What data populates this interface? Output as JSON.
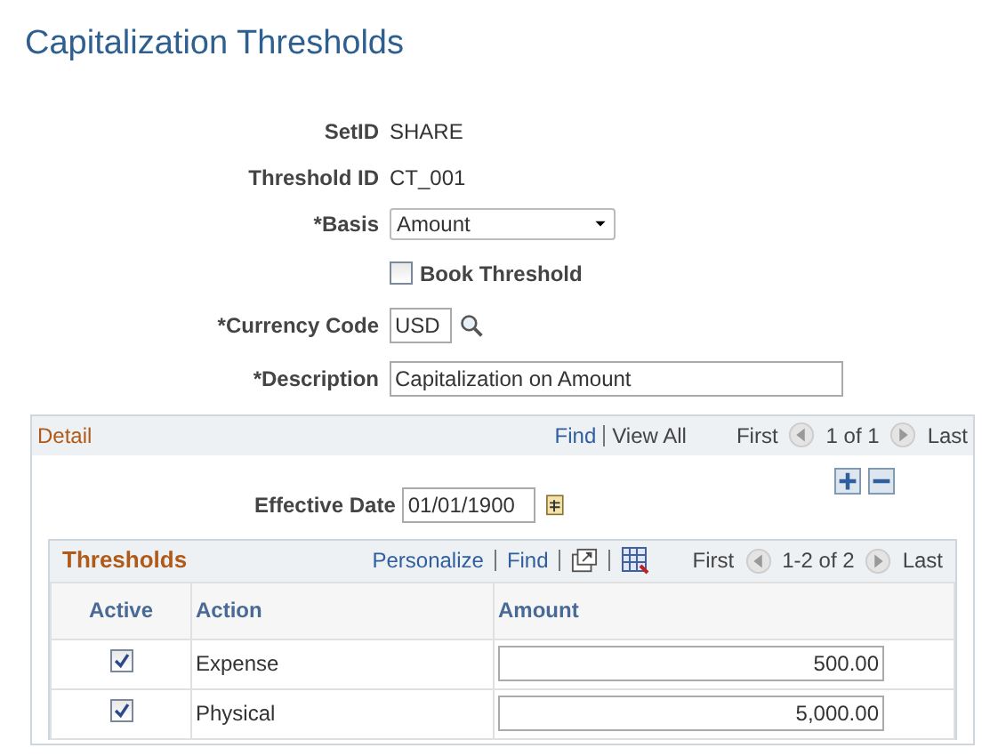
{
  "page_title": "Capitalization Thresholds",
  "fields": [
    {
      "kind": "text",
      "label": "SetID",
      "value": "SHARE"
    },
    {
      "kind": "text",
      "label": "Threshold ID",
      "value": "CT_001"
    },
    {
      "kind": "select",
      "label": "*Basis",
      "value": "Amount"
    },
    {
      "kind": "checkbox",
      "label": "Book Threshold",
      "checked": false
    },
    {
      "kind": "lookup",
      "label": "*Currency Code",
      "value": "USD"
    },
    {
      "kind": "input",
      "label": "*Description",
      "value": "Capitalization on Amount"
    }
  ],
  "detail": {
    "title": "Detail",
    "find": "Find",
    "view_all": "View All",
    "first": "First",
    "count": "1 of 1",
    "last": "Last",
    "effective_date_label": "Effective Date",
    "effective_date": "01/01/1900",
    "grid": {
      "title": "Thresholds",
      "personalize": "Personalize",
      "find": "Find",
      "first": "First",
      "count": "1-2 of 2",
      "last": "Last",
      "columns": [
        "Active",
        "Action",
        "Amount"
      ],
      "rows": [
        {
          "active": true,
          "action": "Expense",
          "amount": "500.00"
        },
        {
          "active": true,
          "action": "Physical",
          "amount": "5,000.00"
        }
      ]
    }
  }
}
